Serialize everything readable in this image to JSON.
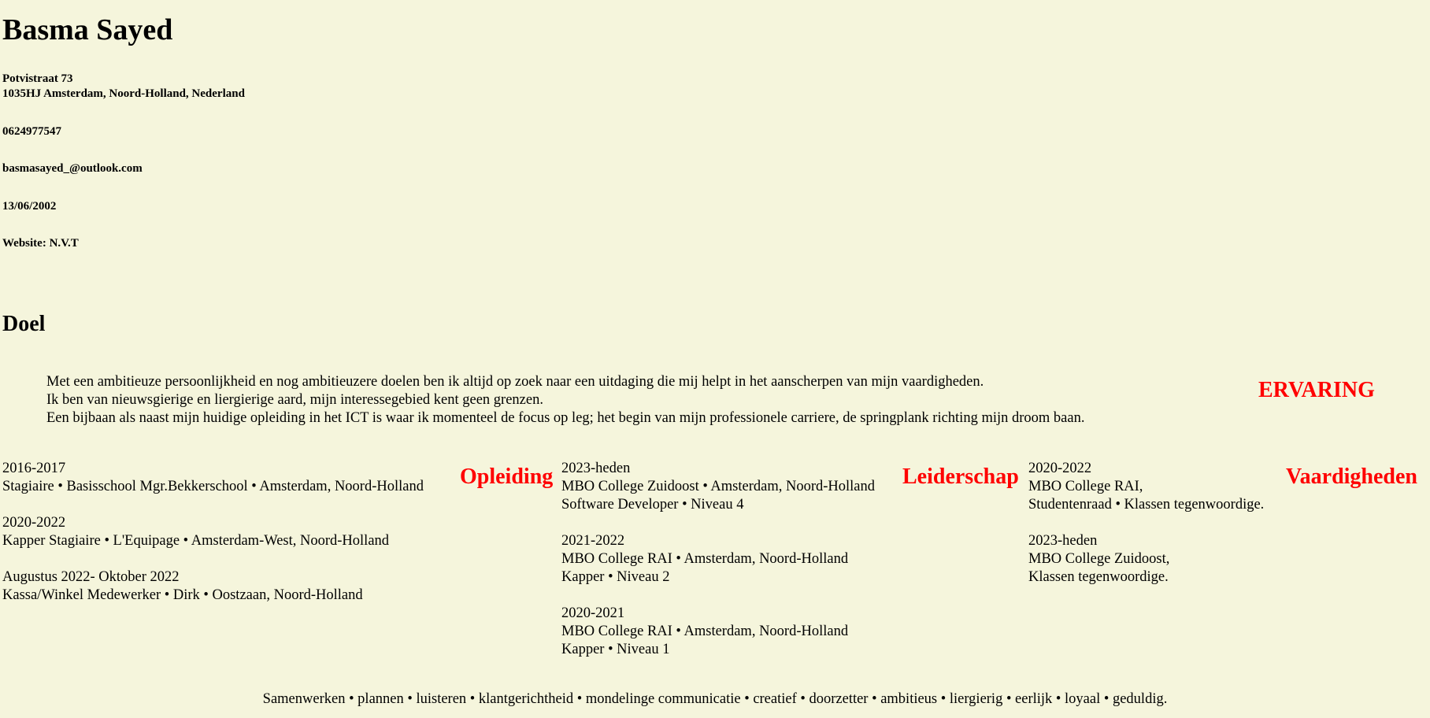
{
  "name": "Basma Sayed",
  "contact": {
    "street": "Potvistraat 73",
    "city": "1035HJ Amsterdam, Noord-Holland, Nederland",
    "phone": "0624977547",
    "email": "basmasayed_@outlook.com",
    "birthdate": "13/06/2002",
    "website": "Website: N.V.T"
  },
  "doel": {
    "heading": "Doel",
    "lines": [
      "Met een ambitieuze persoonlijkheid en nog ambitieuzere doelen ben ik altijd op zoek naar een uitdaging die mij helpt in het aanscherpen van mijn vaardigheden.",
      "Ik ben van nieuwsgierige en liergierige aard, mijn interessegebied kent geen grenzen.",
      "Een bijbaan als naast mijn huidige opleiding in het ICT is waar ik momenteel de focus op leg; het begin van mijn professionele carriere, de springplank richting mijn droom baan."
    ]
  },
  "headings": {
    "ervaring": "ERVARING",
    "opleiding": "Opleiding",
    "leiderschap": "Leiderschap",
    "vaardigheden": "Vaardigheden"
  },
  "ervaring": [
    {
      "period": "2016-2017",
      "desc": "Stagiaire • Basisschool Mgr.Bekkerschool • Amsterdam, Noord-Holland"
    },
    {
      "period": "2020-2022",
      "desc": "Kapper Stagiaire • L'Equipage • Amsterdam-West, Noord-Holland"
    },
    {
      "period": "Augustus 2022- Oktober 2022",
      "desc": "Kassa/Winkel Medewerker • Dirk • Oostzaan, Noord-Holland"
    }
  ],
  "opleiding": [
    {
      "period": "2023-heden",
      "school": "MBO College Zuidoost • Amsterdam, Noord-Holland",
      "course": "Software Developer • Niveau 4"
    },
    {
      "period": "2021-2022",
      "school": "MBO College RAI • Amsterdam, Noord-Holland",
      "course": "Kapper • Niveau 2"
    },
    {
      "period": "2020-2021",
      "school": "MBO College RAI • Amsterdam, Noord-Holland",
      "course": "Kapper • Niveau 1"
    }
  ],
  "leiderschap": [
    {
      "period": "2020-2022",
      "line1": "MBO College RAI,",
      "line2": "Studentenraad • Klassen tegenwoordige."
    },
    {
      "period": "2023-heden",
      "line1": "MBO College Zuidoost,",
      "line2": "Klassen tegenwoordige."
    }
  ],
  "vaardigheden": "Samenwerken • plannen • luisteren • klantgerichtheid • mondelinge communicatie • creatief • doorzetter • ambitieus • liergierig • eerlijk • loyaal • geduldig.",
  "colors": {
    "background": "#f5f5dc",
    "heading_red": "#ff0000"
  }
}
